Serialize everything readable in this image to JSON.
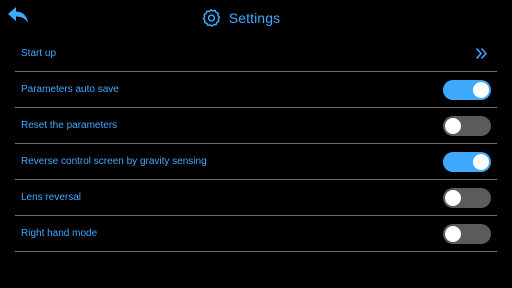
{
  "colors": {
    "accent": "#3fa9ff",
    "background": "#000000",
    "divider": "#6e6e6e",
    "toggle_off": "#5b5b5b",
    "knob": "#ffffff"
  },
  "header": {
    "title": "Settings",
    "back_icon": "back-arrow-icon",
    "title_icon": "gear-icon"
  },
  "settings": {
    "start_up": {
      "label": "Start up",
      "icon": "double-chevron-right-icon"
    },
    "auto_save": {
      "label": "Parameters auto save",
      "enabled": true
    },
    "reset": {
      "label": "Reset the parameters",
      "enabled": false
    },
    "gravity": {
      "label": "Reverse control screen by gravity sensing",
      "enabled": true
    },
    "lens_reversal": {
      "label": "Lens reversal",
      "enabled": false
    },
    "right_hand": {
      "label": "Right hand mode",
      "enabled": false
    }
  }
}
